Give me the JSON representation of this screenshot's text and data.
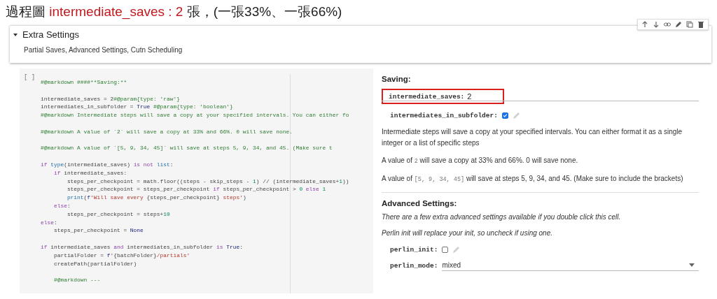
{
  "caption": [
    {
      "kind": "plain",
      "text": "過程圖 "
    },
    {
      "kind": "highlight",
      "text": "intermediate_saves : 2"
    },
    {
      "kind": "plain",
      "text": " 張，(一張33%、一張66%)"
    }
  ],
  "section": {
    "expanded": true,
    "title": "Extra Settings",
    "subtitle": "Partial Saves, Advanced Settings, Cutn Scheduling"
  },
  "code_cell": {
    "run_label": "[ ]",
    "blocks": [
      [
        [
          {
            "kind": "comment",
            "text": "#@markdown ####**Saving:**"
          }
        ]
      ],
      [
        [
          {
            "kind": "plain",
            "text": "intermediate_saves = 2"
          },
          {
            "kind": "comment",
            "text": "#@param{type: 'raw'}"
          }
        ],
        [
          {
            "kind": "plain",
            "text": "intermediates_in_subfolder = "
          },
          {
            "kind": "const",
            "text": "True"
          },
          {
            "kind": "comment",
            "text": " #@param{type: 'boolean'}"
          }
        ],
        [
          {
            "kind": "comment",
            "text": "#@markdown Intermediate steps will save a copy at your specified intervals. You can either fo"
          }
        ]
      ],
      [
        [
          {
            "kind": "comment",
            "text": "#@markdown A value of `2` will save a copy at 33% and 66%. 0 will save none."
          }
        ]
      ],
      [
        [
          {
            "kind": "comment",
            "text": "#@markdown A value of `[5, 9, 34, 45]` will save at steps 5, 9, 34, and 45. (Make sure t"
          }
        ]
      ],
      [
        [
          {
            "kind": "keyword",
            "text": "if "
          },
          {
            "kind": "builtin",
            "text": "type"
          },
          {
            "kind": "plain",
            "text": "(intermediate_saves) "
          },
          {
            "kind": "keyword",
            "text": "is not "
          },
          {
            "kind": "builtin",
            "text": "list"
          },
          {
            "kind": "plain",
            "text": ":"
          }
        ],
        [
          {
            "kind": "keyword",
            "text": "    if "
          },
          {
            "kind": "plain",
            "text": "intermediate_saves:"
          }
        ],
        [
          {
            "kind": "plain",
            "text": "        steps_per_checkpoint = math.floor((steps - skip_steps - "
          },
          {
            "kind": "number",
            "text": "1"
          },
          {
            "kind": "plain",
            "text": ") // (intermediate_saves+"
          },
          {
            "kind": "number",
            "text": "1"
          },
          {
            "kind": "plain",
            "text": "))"
          }
        ],
        [
          {
            "kind": "plain",
            "text": "        steps_per_checkpoint = steps_per_checkpoint "
          },
          {
            "kind": "keyword",
            "text": "if "
          },
          {
            "kind": "plain",
            "text": "steps_per_checkpoint > "
          },
          {
            "kind": "number",
            "text": "0"
          },
          {
            "kind": "keyword",
            "text": " else "
          },
          {
            "kind": "number",
            "text": "1"
          }
        ],
        [
          {
            "kind": "builtin",
            "text": "        print"
          },
          {
            "kind": "plain",
            "text": "("
          },
          {
            "kind": "const",
            "text": "f"
          },
          {
            "kind": "string",
            "text": "'Will save every "
          },
          {
            "kind": "plain",
            "text": "{steps_per_checkpoint}"
          },
          {
            "kind": "string",
            "text": " steps'"
          },
          {
            "kind": "plain",
            "text": ")"
          }
        ],
        [
          {
            "kind": "keyword",
            "text": "    else"
          },
          {
            "kind": "plain",
            "text": ":"
          }
        ],
        [
          {
            "kind": "plain",
            "text": "        steps_per_checkpoint = steps+"
          },
          {
            "kind": "number",
            "text": "10"
          }
        ],
        [
          {
            "kind": "keyword",
            "text": "else"
          },
          {
            "kind": "plain",
            "text": ":"
          }
        ],
        [
          {
            "kind": "plain",
            "text": "    steps_per_checkpoint = "
          },
          {
            "kind": "const",
            "text": "None"
          }
        ]
      ],
      [
        [
          {
            "kind": "keyword",
            "text": "if "
          },
          {
            "kind": "plain",
            "text": "intermediate_saves "
          },
          {
            "kind": "keyword",
            "text": "and "
          },
          {
            "kind": "plain",
            "text": "intermediates_in_subfolder "
          },
          {
            "kind": "keyword",
            "text": "is "
          },
          {
            "kind": "const",
            "text": "True"
          },
          {
            "kind": "plain",
            "text": ":"
          }
        ],
        [
          {
            "kind": "plain",
            "text": "    partialFolder = "
          },
          {
            "kind": "const",
            "text": "f"
          },
          {
            "kind": "string",
            "text": "'"
          },
          {
            "kind": "plain",
            "text": "{batchFolder}"
          },
          {
            "kind": "string",
            "text": "/partials'"
          }
        ],
        [
          {
            "kind": "plain",
            "text": "    createPath(partialFolder)"
          }
        ]
      ],
      [
        [
          {
            "kind": "comment",
            "text": "    #@markdown ---"
          }
        ]
      ]
    ]
  },
  "form": {
    "sections": [
      {
        "heading": "Saving:",
        "items": [
          {
            "kind": "text",
            "label": "intermediate_saves:",
            "value": "2",
            "highlighted": true
          },
          {
            "kind": "checkbox",
            "label": "intermediates_in_subfolder:",
            "checked": true
          },
          {
            "kind": "para",
            "italic": false,
            "parts": [
              {
                "kind": "text",
                "text": "Intermediate steps will save a copy at your specified intervals. You can either format it as a single integer or a list of specific steps"
              }
            ]
          },
          {
            "kind": "para",
            "italic": false,
            "parts": [
              {
                "kind": "text",
                "text": "A value of "
              },
              {
                "kind": "code",
                "text": "2"
              },
              {
                "kind": "text",
                "text": " will save a copy at 33% and 66%. 0 will save none."
              }
            ]
          },
          {
            "kind": "para",
            "italic": false,
            "parts": [
              {
                "kind": "text",
                "text": "A value of "
              },
              {
                "kind": "code",
                "text": "[5, 9, 34, 45]"
              },
              {
                "kind": "text",
                "text": " will save at steps 5, 9, 34, and 45. (Make sure to include the brackets)"
              }
            ]
          }
        ]
      },
      {
        "heading": "Advanced Settings:",
        "items": [
          {
            "kind": "para",
            "italic": true,
            "parts": [
              {
                "kind": "text",
                "text": "There are a few extra advanced settings available if you double click this cell."
              }
            ]
          },
          {
            "kind": "para",
            "italic": true,
            "parts": [
              {
                "kind": "text",
                "text": "Perlin init will replace your init, so uncheck if using one."
              }
            ]
          },
          {
            "kind": "checkbox",
            "label": "perlin_init:",
            "checked": false
          },
          {
            "kind": "dropdown",
            "label": "perlin_mode:",
            "value": "mixed"
          }
        ]
      }
    ]
  }
}
